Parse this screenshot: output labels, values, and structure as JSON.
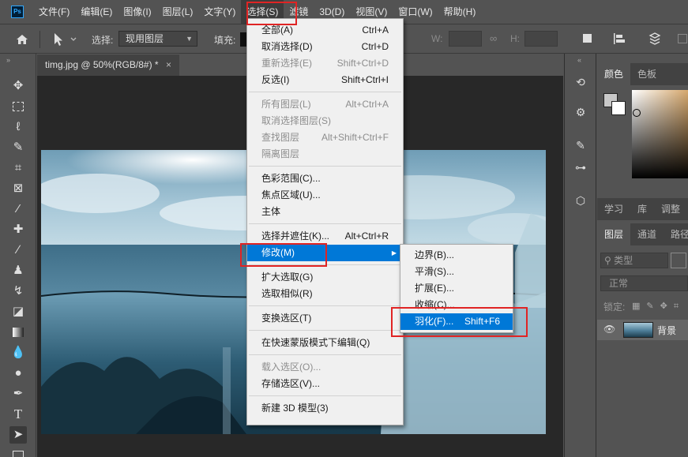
{
  "app": {
    "logo": "Ps"
  },
  "menubar": {
    "items": [
      "文件(F)",
      "编辑(E)",
      "图像(I)",
      "图层(L)",
      "文字(Y)",
      "选择(S)",
      "滤镜",
      "3D(D)",
      "视图(V)",
      "窗口(W)",
      "帮助(H)"
    ],
    "active_index": 5
  },
  "options": {
    "select_label": "选择:",
    "select_value": "现用图层",
    "fill_label": "填充:",
    "w_label": "W:",
    "h_label": "H:"
  },
  "document": {
    "tab_title": "timg.jpg @ 50%(RGB/8#) *",
    "close_glyph": "×"
  },
  "select_menu": {
    "items": [
      {
        "label": "全部(A)",
        "shortcut": "Ctrl+A",
        "disabled": false
      },
      {
        "label": "取消选择(D)",
        "shortcut": "Ctrl+D",
        "disabled": false
      },
      {
        "label": "重新选择(E)",
        "shortcut": "Shift+Ctrl+D",
        "disabled": true
      },
      {
        "label": "反选(I)",
        "shortcut": "Shift+Ctrl+I",
        "disabled": false
      },
      {
        "separator": true
      },
      {
        "label": "所有图层(L)",
        "shortcut": "Alt+Ctrl+A",
        "disabled": true
      },
      {
        "label": "取消选择图层(S)",
        "shortcut": "",
        "disabled": true
      },
      {
        "label": "查找图层",
        "shortcut": "Alt+Shift+Ctrl+F",
        "disabled": true
      },
      {
        "label": "隔离图层",
        "shortcut": "",
        "disabled": true
      },
      {
        "separator": true
      },
      {
        "label": "色彩范围(C)...",
        "shortcut": "",
        "disabled": false
      },
      {
        "label": "焦点区域(U)...",
        "shortcut": "",
        "disabled": false
      },
      {
        "label": "主体",
        "shortcut": "",
        "disabled": false
      },
      {
        "separator": true
      },
      {
        "label": "选择并遮住(K)...",
        "shortcut": "Alt+Ctrl+R",
        "disabled": false
      },
      {
        "label": "修改(M)",
        "shortcut": "",
        "disabled": false,
        "submenu": true,
        "highlighted": true
      },
      {
        "separator": true
      },
      {
        "label": "扩大选取(G)",
        "shortcut": "",
        "disabled": false
      },
      {
        "label": "选取相似(R)",
        "shortcut": "",
        "disabled": false
      },
      {
        "separator": true
      },
      {
        "label": "变换选区(T)",
        "shortcut": "",
        "disabled": false
      },
      {
        "separator": true
      },
      {
        "label": "在快速蒙版模式下编辑(Q)",
        "shortcut": "",
        "disabled": false
      },
      {
        "separator": true
      },
      {
        "label": "载入选区(O)...",
        "shortcut": "",
        "disabled": true
      },
      {
        "label": "存储选区(V)...",
        "shortcut": "",
        "disabled": false
      },
      {
        "separator": true
      },
      {
        "label": "新建 3D 模型(3)",
        "shortcut": "",
        "disabled": false
      }
    ]
  },
  "modify_submenu": {
    "items": [
      {
        "label": "边界(B)...",
        "shortcut": ""
      },
      {
        "label": "平滑(S)...",
        "shortcut": ""
      },
      {
        "label": "扩展(E)...",
        "shortcut": ""
      },
      {
        "label": "收缩(C)...",
        "shortcut": ""
      },
      {
        "label": "羽化(F)...",
        "shortcut": "Shift+F6",
        "highlighted": true
      }
    ]
  },
  "panels": {
    "color_tabs": [
      "颜色",
      "色板"
    ],
    "learn_tabs": [
      "学习",
      "库",
      "调整"
    ],
    "layer_tabs": [
      "图层",
      "通道",
      "路径"
    ],
    "filter_kind": "类型",
    "blend_mode": "正常",
    "lock_label": "锁定:",
    "layer_name": "背景"
  },
  "colors": {
    "ui_bg": "#535353",
    "canvas_bg": "#282828",
    "menu_bg": "#f0f0f0",
    "highlight": "#0078d7",
    "annotation_red": "#e02424"
  }
}
